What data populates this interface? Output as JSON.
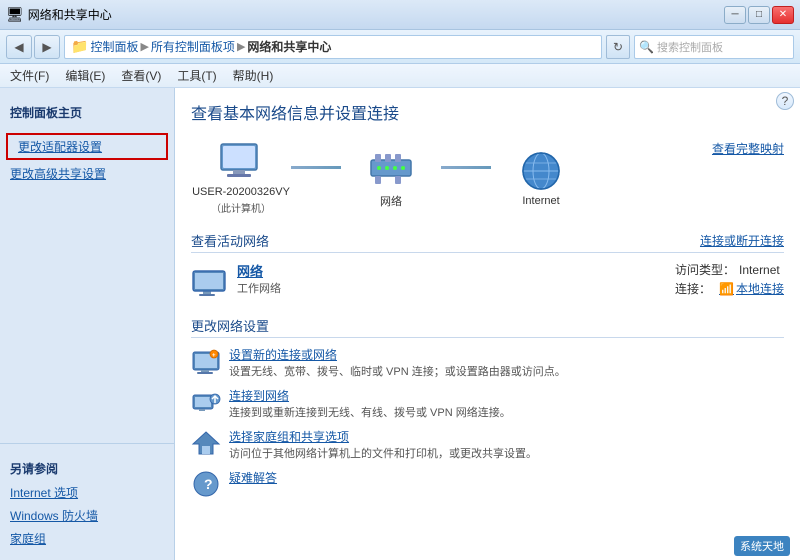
{
  "titlebar": {
    "title": "网络和共享中心",
    "min_label": "─",
    "max_label": "□",
    "close_label": "✕"
  },
  "addressbar": {
    "back_icon": "◀",
    "forward_icon": "▶",
    "breadcrumbs": [
      {
        "label": "控制面板",
        "link": true
      },
      {
        "label": "所有控制面板项",
        "link": true
      },
      {
        "label": "网络和共享中心",
        "link": false
      }
    ],
    "refresh_icon": "↻",
    "search_placeholder": "搜索控制面板",
    "search_icon": "🔍"
  },
  "menubar": {
    "items": [
      {
        "label": "文件(F)"
      },
      {
        "label": "编辑(E)"
      },
      {
        "label": "查看(V)"
      },
      {
        "label": "工具(T)"
      },
      {
        "label": "帮助(H)"
      }
    ]
  },
  "sidebar": {
    "section_title": "控制面板主页",
    "links": [
      {
        "label": "更改适配器设置",
        "highlighted": true
      },
      {
        "label": "更改高级共享设置",
        "highlighted": false
      }
    ],
    "also_section": {
      "title": "另请参阅",
      "links": [
        {
          "label": "Internet 选项"
        },
        {
          "label": "Windows 防火墙"
        },
        {
          "label": "家庭组"
        }
      ]
    }
  },
  "content": {
    "title": "查看基本网络信息并设置连接",
    "view_full_link": "查看完整映射",
    "network_diagram": {
      "nodes": [
        {
          "label": "USER-20200326VY",
          "sublabel": "（此计算机）",
          "icon_type": "computer"
        },
        {
          "label": "网络",
          "sublabel": "",
          "icon_type": "switch"
        },
        {
          "label": "Internet",
          "sublabel": "",
          "icon_type": "globe"
        }
      ]
    },
    "active_networks_section": {
      "title": "查看活动网络",
      "connect_link": "连接或断开连接",
      "network": {
        "name": "网络",
        "type_label": "工作网络",
        "access_type_label": "访问类型：",
        "access_type_value": "Internet",
        "connection_label": "连接：",
        "connection_value": "本地连接"
      }
    },
    "change_settings_section": {
      "title": "更改网络设置",
      "items": [
        {
          "title": "设置新的连接或网络",
          "desc": "设置无线、宽带、拨号、临时或 VPN 连接；或设置路由器或访问点。",
          "icon_type": "setup"
        },
        {
          "title": "连接到网络",
          "desc": "连接到或重新连接到无线、有线、拨号或 VPN 网络连接。",
          "icon_type": "connect"
        },
        {
          "title": "选择家庭组和共享选项",
          "desc": "访问位于其他网络计算机上的文件和打印机，或更改共享设置。",
          "icon_type": "homegroup"
        },
        {
          "title": "疑难解答",
          "desc": "",
          "icon_type": "troubleshoot"
        }
      ]
    }
  },
  "watermark": {
    "text": "系统天地"
  },
  "help_icon": "?"
}
